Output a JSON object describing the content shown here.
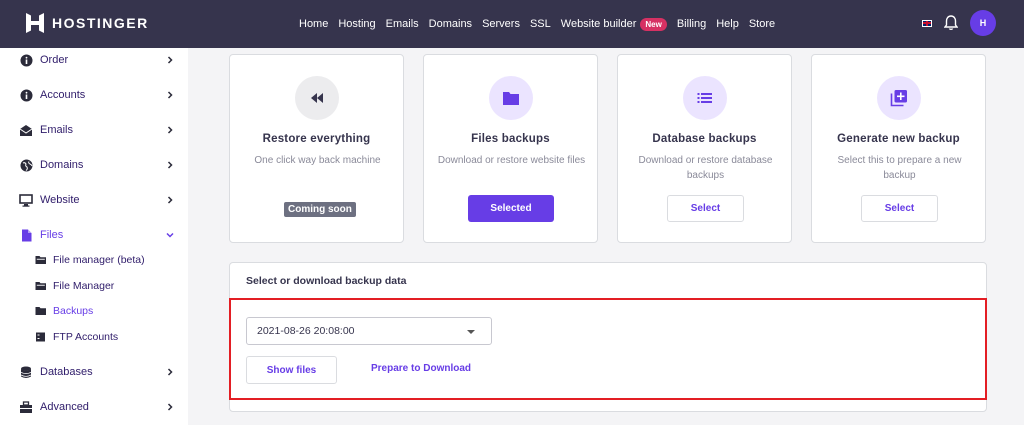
{
  "header": {
    "logo_text": "HOSTINGER",
    "nav": [
      {
        "label": "Home"
      },
      {
        "label": "Hosting"
      },
      {
        "label": "Emails"
      },
      {
        "label": "Domains"
      },
      {
        "label": "Servers"
      },
      {
        "label": "SSL"
      },
      {
        "label": "Website builder",
        "badge": "New"
      },
      {
        "label": "Billing"
      },
      {
        "label": "Help"
      },
      {
        "label": "Store"
      }
    ],
    "avatar_text": "H"
  },
  "sidebar": {
    "items": [
      {
        "label": "Order",
        "icon": "info-circle-icon"
      },
      {
        "label": "Accounts",
        "icon": "info-circle-icon"
      },
      {
        "label": "Emails",
        "icon": "envelope-open-icon"
      },
      {
        "label": "Domains",
        "icon": "globe-icon"
      },
      {
        "label": "Website",
        "icon": "monitor-icon"
      },
      {
        "label": "Files",
        "icon": "file-icon"
      },
      {
        "label": "Databases",
        "icon": "database-icon"
      },
      {
        "label": "Advanced",
        "icon": "toolbox-icon"
      }
    ],
    "sub_items": [
      {
        "label": "File manager (beta)",
        "icon": "folder-open-icon"
      },
      {
        "label": "File Manager",
        "icon": "folder-open-icon"
      },
      {
        "label": "Backups",
        "icon": "folder-icon"
      },
      {
        "label": "FTP Accounts",
        "icon": "server-icon"
      }
    ]
  },
  "cards": [
    {
      "title": "Restore everything",
      "desc": "One click way back machine",
      "button": "Coming soon",
      "icon": "rewind-icon"
    },
    {
      "title": "Files backups",
      "desc": "Download or restore website files",
      "button": "Selected",
      "icon": "folder-icon"
    },
    {
      "title": "Database backups",
      "desc": "Download or restore database backups",
      "button": "Select",
      "icon": "list-icon"
    },
    {
      "title": "Generate new backup",
      "desc": "Select this to prepare a new backup",
      "button": "Select",
      "icon": "add-copy-icon"
    }
  ],
  "backup_panel": {
    "title": "Select or download backup data",
    "selected_date": "2021-08-26 20:08:00",
    "show_files_label": "Show files",
    "prepare_label": "Prepare to Download"
  },
  "colors": {
    "brand": "#673de6",
    "topbar": "#36344d",
    "highlight": "#e31e24"
  }
}
